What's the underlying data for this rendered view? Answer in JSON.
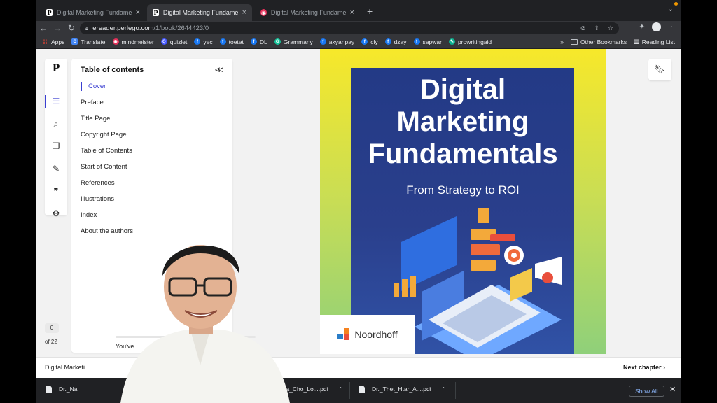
{
  "browser": {
    "tabs": [
      {
        "title": "Digital Marketing Fundamentals",
        "favicon": "P",
        "active": false
      },
      {
        "title": "Digital Marketing Fundamentals",
        "favicon": "P",
        "active": true
      },
      {
        "title": "Digital Marketing Fundamentals",
        "favicon": "mindmeister-icon",
        "active": false
      }
    ],
    "new_tab": "+",
    "tab_menu": "⌄",
    "url_host": "ereader.perlego.com",
    "url_path": "/1/book/2644423/0",
    "bookmarks": [
      {
        "label": "Apps",
        "icon": "apps-grid-icon"
      },
      {
        "label": "Translate",
        "icon": "translate-icon"
      },
      {
        "label": "mindmeister",
        "icon": "mindmeister-icon"
      },
      {
        "label": "quizlet",
        "icon": "quizlet-icon"
      },
      {
        "label": "yec",
        "icon": "facebook-icon"
      },
      {
        "label": "toetet",
        "icon": "facebook-icon"
      },
      {
        "label": "DL",
        "icon": "facebook-icon"
      },
      {
        "label": "Grammarly",
        "icon": "grammarly-icon"
      },
      {
        "label": "akyanpay",
        "icon": "facebook-icon"
      },
      {
        "label": "cly",
        "icon": "facebook-icon"
      },
      {
        "label": "dzay",
        "icon": "facebook-icon"
      },
      {
        "label": "sapwar",
        "icon": "facebook-icon"
      },
      {
        "label": "prowritingaid",
        "icon": "prowritingaid-icon"
      }
    ],
    "bookmarks_overflow": "»",
    "other_bookmarks": "Other Bookmarks",
    "reading_list": "Reading List"
  },
  "reader": {
    "logo": "P",
    "toc_title": "Table of contents",
    "toc_collapse": "<<",
    "toc_items": [
      "Cover",
      "Preface",
      "Title Page",
      "Copyright Page",
      "Table of Contents",
      "Start of Content",
      "References",
      "Illustrations",
      "Index",
      "About the authors"
    ],
    "current_item": "Cover",
    "page_number": "0",
    "page_total": "of 22",
    "progress_text": "You've",
    "progress_fraction": 0,
    "chapter_label": "Digital Marketi",
    "next_chapter": "Next chapter"
  },
  "cover": {
    "title_lines": [
      "Digital",
      "Marketing",
      "Fundamentals"
    ],
    "subtitle": "From Strategy to ROI",
    "publisher": "Noordhoff"
  },
  "downloads": {
    "items": [
      "Dr._Na",
      "Sayama_Cho_Lo....pdf",
      "Dr._Thet_Htar_A....pdf"
    ],
    "show_all": "Show All",
    "close": "✕"
  },
  "colors": {
    "accent": "#3a3fd1",
    "cover_blue": "#2a3f8c",
    "cover_yellow": "#f7e82a",
    "chrome_dark": "#202124"
  }
}
